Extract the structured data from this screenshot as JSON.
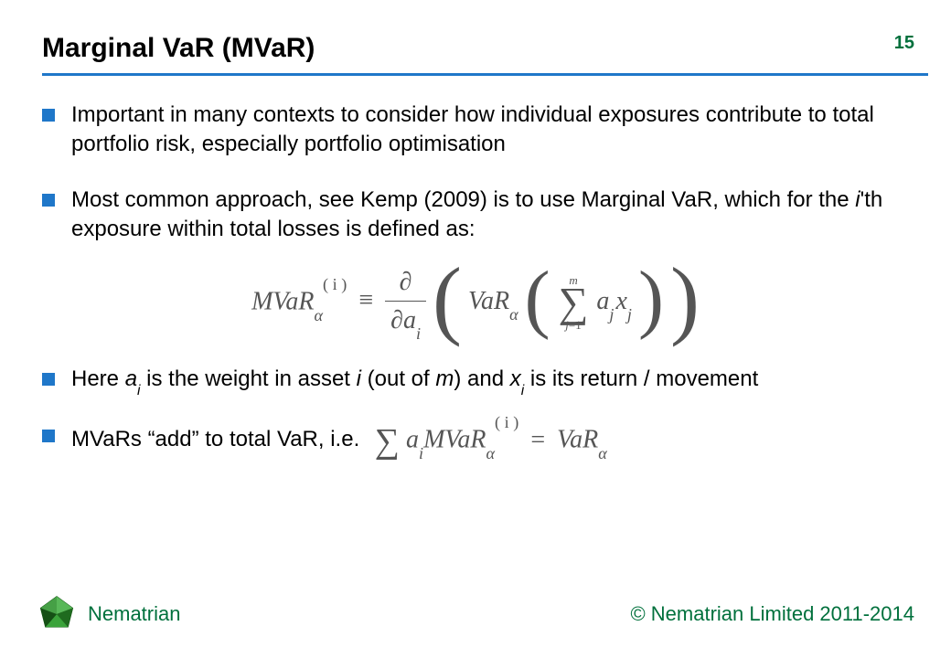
{
  "slide": {
    "title": "Marginal VaR (MVaR)",
    "page_number": "15"
  },
  "bullets": {
    "b1": "Important in many contexts to consider how individual exposures contribute to total portfolio risk, especially portfolio optimisation",
    "b2_pre": "Most common approach, see Kemp (2009) is to use Marginal VaR, which for the ",
    "b2_i": "i",
    "b2_post": "'th exposure within total losses is defined as:",
    "b3_pre": "Here ",
    "b3_ai": "a",
    "b3_ai_sub": "i",
    "b3_mid1": " is the weight in asset ",
    "b3_i2": "i",
    "b3_mid2": " (out of ",
    "b3_m": "m",
    "b3_mid3": ") and ",
    "b3_xi": "x",
    "b3_xi_sub": "i",
    "b3_post": " is its return / movement",
    "b4": "MVaRs “add” to total VaR, i.e."
  },
  "math": {
    "mvar": "MVaR",
    "alpha": "α",
    "i_sup": "( i )",
    "equiv": "≡",
    "partial": "∂",
    "ai": "a",
    "ai_sub": "i",
    "var": "VaR",
    "sum_top": "m",
    "sigma": "∑",
    "sum_bot": "j=1",
    "aj": "a",
    "aj_sub": "j",
    "xj": "x",
    "xj_sub": "j",
    "eq2_sum": "∑",
    "eq2_ai": "a",
    "eq2_ai_sub": "i",
    "eq2_mvar": "MVaR",
    "eq2_equals": "=",
    "eq2_var": "VaR"
  },
  "footer": {
    "brand": "Nematrian",
    "copyright": "© Nematrian Limited 2011-2014"
  },
  "colors": {
    "accent_blue": "#1f77c9",
    "brand_green": "#00703c",
    "math_gray": "#555555"
  }
}
